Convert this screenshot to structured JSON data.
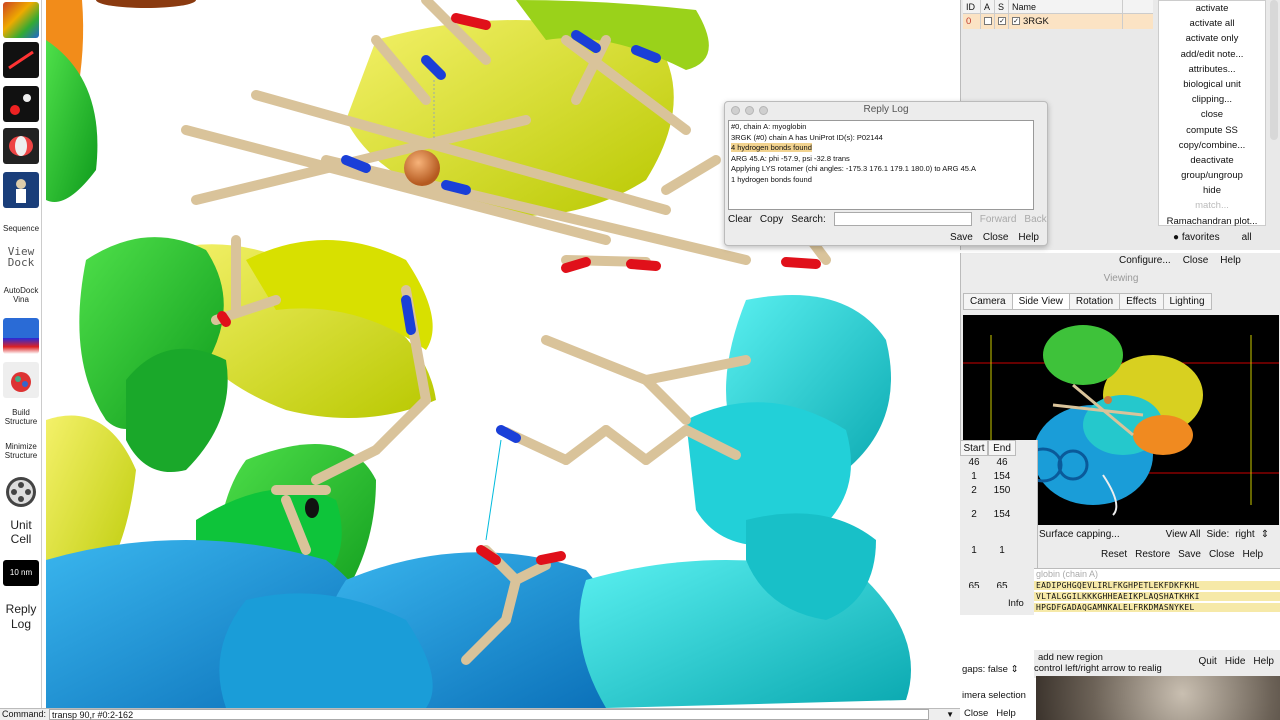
{
  "toolbar": {
    "tools": [
      {
        "name": "model-panel-tool",
        "label": ""
      },
      {
        "name": "tool-2",
        "label": ""
      },
      {
        "name": "tool-3",
        "label": ""
      },
      {
        "name": "tool-4",
        "label": ""
      },
      {
        "name": "tool-5",
        "label": ""
      },
      {
        "name": "sequence-tool",
        "label": "Sequence"
      },
      {
        "name": "viewdock-tool",
        "label": "View Dock"
      },
      {
        "name": "autodock-tool",
        "label": "AutoDock Vina"
      },
      {
        "name": "tool-9",
        "label": ""
      },
      {
        "name": "tool-10",
        "label": ""
      },
      {
        "name": "build-structure-tool",
        "label": "Build Structure"
      },
      {
        "name": "minimize-structure-tool",
        "label": "Minimize Structure"
      },
      {
        "name": "tool-13",
        "label": ""
      },
      {
        "name": "unit-cell-tool",
        "label": "Unit Cell"
      },
      {
        "name": "scale-bar-tool",
        "label": "10 nm"
      },
      {
        "name": "reply-log-tool",
        "label": "Reply Log"
      }
    ]
  },
  "command": {
    "label": "Command:",
    "value": "transp 90,r #0:2-162"
  },
  "reply_log": {
    "title": "Reply Log",
    "lines": [
      "#0, chain A: myoglobin",
      "3RGK (#0) chain A has UniProt ID(s): P02144",
      "4 hydrogen bonds found",
      "ARG 45.A: phi -57.9, psi -32.8 trans",
      "Applying LYS rotamer (chi angles: -175.3 176.1 179.1 180.0) to ARG 45.A",
      "1 hydrogen bonds found"
    ],
    "clear": "Clear",
    "copy": "Copy",
    "search_label": "Search:",
    "forward": "Forward",
    "back": "Back",
    "save": "Save",
    "close": "Close",
    "help": "Help"
  },
  "model_panel": {
    "headers": {
      "id": "ID",
      "a": "A",
      "s": "S",
      "name": "Name"
    },
    "models": [
      {
        "id": "0",
        "name": "3RGK"
      }
    ],
    "commands": [
      "activate",
      "activate all",
      "activate only",
      "add/edit note...",
      "attributes...",
      "biological unit",
      "clipping...",
      "close",
      "compute SS",
      "copy/combine...",
      "deactivate",
      "group/ungroup",
      "hide",
      "match...",
      "Ramachandran plot..."
    ],
    "favorites": "favorites",
    "all": "all",
    "configure": "Configure...",
    "close": "Close",
    "help": "Help"
  },
  "side_view": {
    "title": "Viewing",
    "tabs": [
      "Camera",
      "Side View",
      "Rotation",
      "Effects",
      "Lighting"
    ],
    "surface_capping": "Surface capping...",
    "view_all": "View All",
    "side_label": "Side:",
    "side_value": "right",
    "reset": "Reset",
    "restore": "Restore",
    "save": "Save",
    "close": "Close",
    "help": "Help"
  },
  "regions": {
    "headers": [
      "Start",
      "End"
    ],
    "rows": [
      [
        "46",
        "46"
      ],
      [
        "1",
        "154"
      ],
      [
        "2",
        "150"
      ],
      [
        "2",
        "154"
      ],
      [
        "1",
        "1"
      ],
      [
        "65",
        "65"
      ]
    ],
    "info": "Info"
  },
  "sequence": {
    "title": "globin (chain A)",
    "lines": [
      "EADIPGHGQEVLIRLFKGHPETLEKFDKFKHL",
      "VLTALGGILKKKGHHEAEIKPLAQSHATKHKI",
      "HPGDFGADAQGAMNKALELFRKDMASNYKEL"
    ],
    "add_region": "add new region",
    "hint": "control left/right arrow to realig",
    "gaps_label": "gaps:",
    "gaps_value": "false",
    "quit": "Quit",
    "hide": "Hide",
    "help": "Help"
  },
  "selection_inspector": "imera selection",
  "bottom": {
    "close": "Close",
    "help": "Help"
  },
  "colors": {
    "tan_stick": "#d9c39a",
    "oxygen": "#e0101a",
    "nitrogen": "#1a3fd8",
    "iron": "#d07a3a"
  }
}
